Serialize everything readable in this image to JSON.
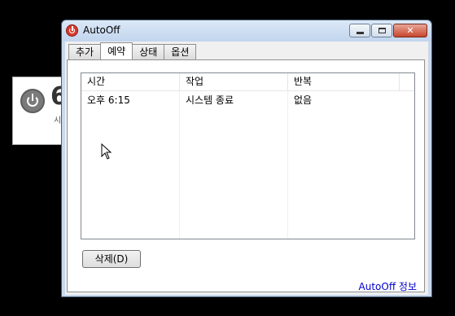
{
  "background_widget": {
    "big_text": "6",
    "small_text": "시"
  },
  "window": {
    "title": "AutoOff",
    "close_glyph": "✕"
  },
  "tabs": [
    {
      "label": "추가",
      "active": false
    },
    {
      "label": "예약",
      "active": true
    },
    {
      "label": "상태",
      "active": false
    },
    {
      "label": "옵션",
      "active": false
    }
  ],
  "table": {
    "columns": [
      "시간",
      "작업",
      "반복"
    ],
    "rows": [
      {
        "time": "오후 6:15",
        "action": "시스템 종료",
        "repeat": "없음"
      }
    ]
  },
  "buttons": {
    "delete_label": "삭제(D)"
  },
  "footer": {
    "about_link": "AutoOff 정보"
  },
  "colors": {
    "accent_link": "#0000cc",
    "close_button": "#c9462f",
    "app_icon": "#d63a2e"
  }
}
